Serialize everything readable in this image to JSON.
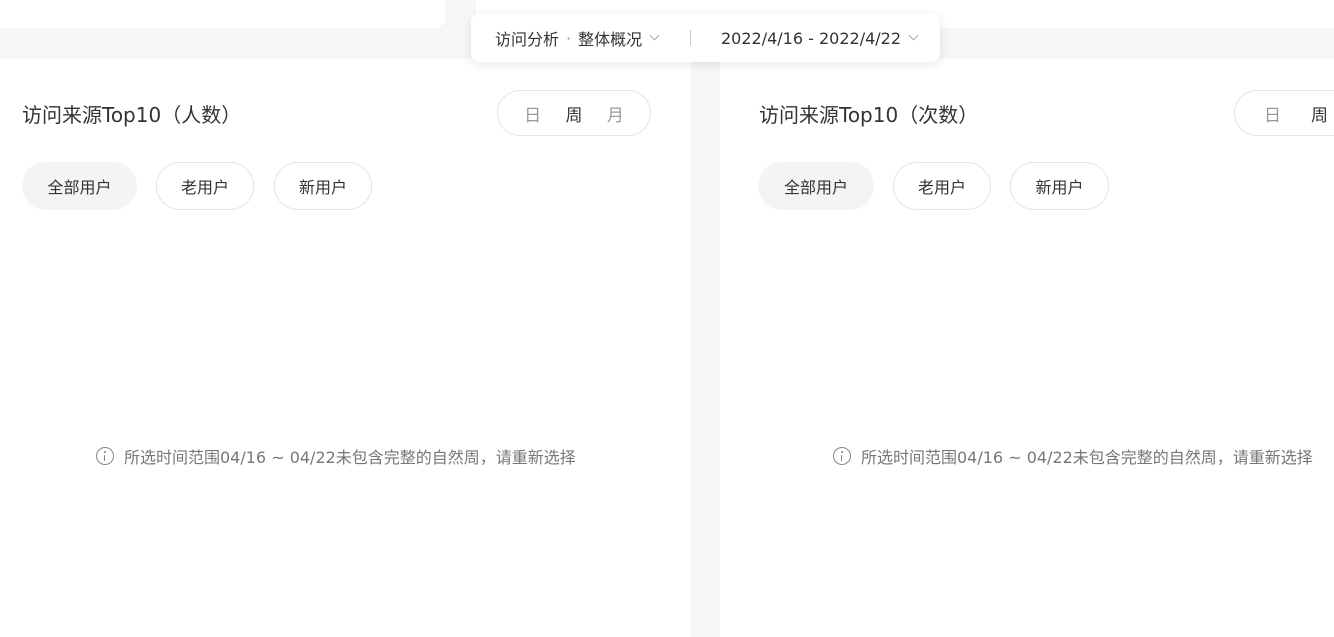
{
  "filter_bar": {
    "analysis_label": "访问分析",
    "separator": "·",
    "analysis_value": "整体概况",
    "date_range": "2022/4/16 - 2022/4/22"
  },
  "panels": [
    {
      "title": "访问来源Top10（人数）",
      "period_options": [
        "日",
        "周",
        "月"
      ],
      "active_period": "周",
      "segments": [
        "全部用户",
        "老用户",
        "新用户"
      ],
      "active_segment": "全部用户",
      "notice": "所选时间范围04/16 ~ 04/22未包含完整的自然周，请重新选择"
    },
    {
      "title": "访问来源Top10（次数）",
      "period_options": [
        "日",
        "周"
      ],
      "active_period": "周",
      "segments": [
        "全部用户",
        "老用户",
        "新用户"
      ],
      "active_segment": "全部用户",
      "notice": "所选时间范围04/16 ~ 04/22未包含完整的自然周，请重新选择"
    }
  ],
  "colors": {
    "background": "#f6f6f6",
    "panel": "#ffffff",
    "text_primary": "#333333",
    "text_muted": "#999999",
    "border": "#e5e5e5",
    "active_chip": "#f4f4f4"
  }
}
